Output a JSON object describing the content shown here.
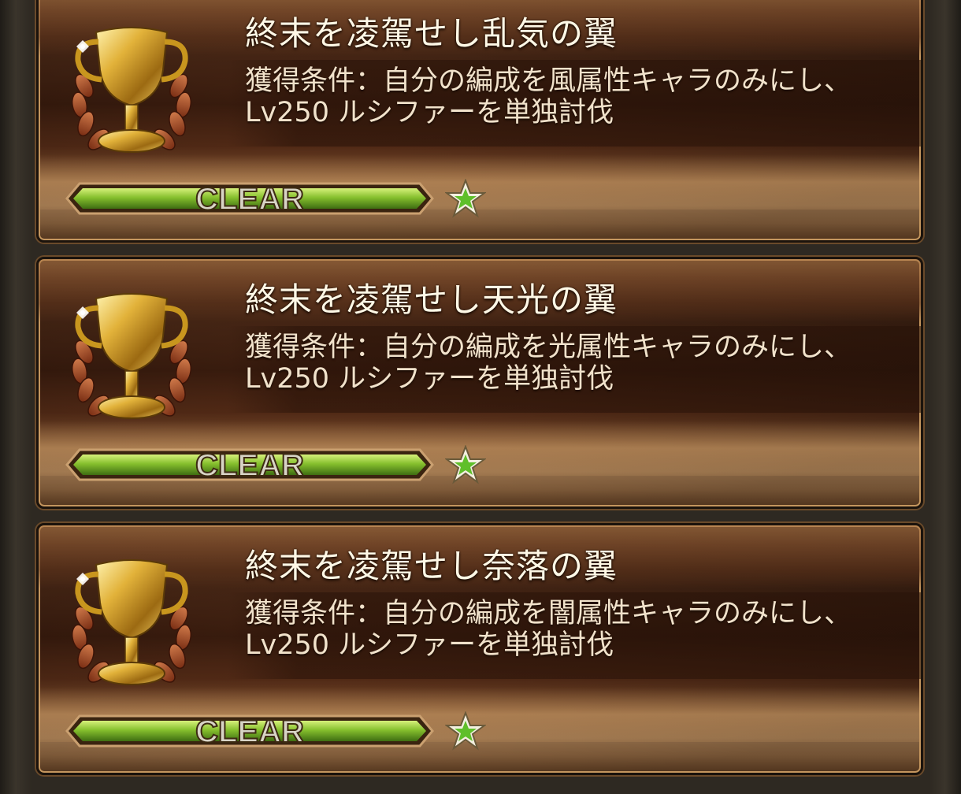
{
  "achievements": [
    {
      "title": "終末を凌駕せし乱気の翼",
      "condition_line1": "獲得条件：自分の編成を風属性キャラのみにし、",
      "condition_line2": "Lv250 ルシファーを単独討伐",
      "status": "CLEAR",
      "icon": "trophy-icon",
      "star_icon": "star-icon"
    },
    {
      "title": "終末を凌駕せし天光の翼",
      "condition_line1": "獲得条件：自分の編成を光属性キャラのみにし、",
      "condition_line2": "Lv250 ルシファーを単独討伐",
      "status": "CLEAR",
      "icon": "trophy-icon",
      "star_icon": "star-icon"
    },
    {
      "title": "終末を凌駕せし奈落の翼",
      "condition_line1": "獲得条件：自分の編成を闇属性キャラのみにし、",
      "condition_line2": "Lv250 ルシファーを単独討伐",
      "status": "CLEAR",
      "icon": "trophy-icon",
      "star_icon": "star-icon"
    }
  ],
  "colors": {
    "bar_green": "#7fb52a",
    "star_green": "#5fbf2a",
    "title_text": "#fff8e6"
  }
}
